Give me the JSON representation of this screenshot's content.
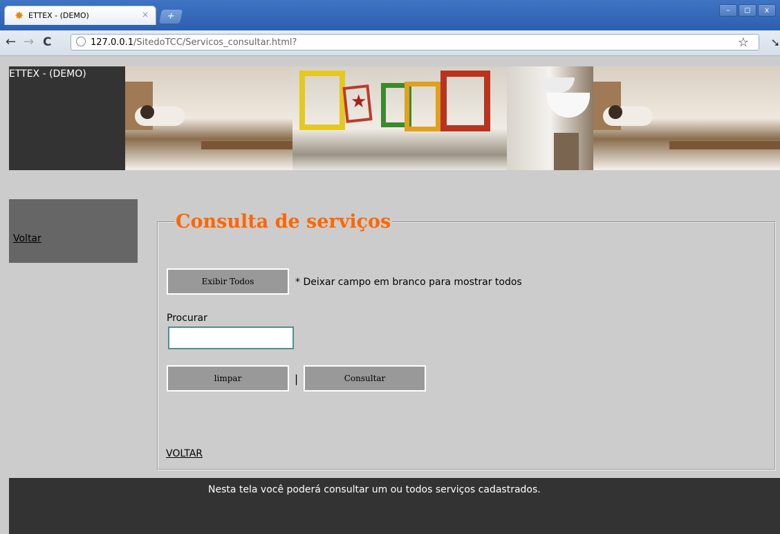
{
  "browser": {
    "tab_title": "ETTEX - (DEMO)",
    "tab_close": "×",
    "new_tab": "+",
    "url_host": "127.0.0.1",
    "url_path": "/SitedoTCC/Servicos_consultar.html?",
    "window_controls": {
      "minimize": "–",
      "maximize": "◻",
      "close": "x"
    },
    "icons": {
      "back": "←",
      "forward": "→",
      "reload": "C",
      "star": "☆",
      "wrench": "➘"
    }
  },
  "header": {
    "site_title": "ETTEX - (DEMO)"
  },
  "sidebar": {
    "links": [
      {
        "label": "Voltar"
      }
    ]
  },
  "main": {
    "legend": "Consulta de serviços",
    "show_all_button": "Exibir Todos",
    "show_all_note": "* Deixar campo em branco para mostrar todos",
    "search_label": "Procurar",
    "search_value": "",
    "clear_button": "limpar",
    "separator": "|",
    "query_button": "Consultar",
    "back_link": "VOLTAR"
  },
  "footer": {
    "text": "Nesta tela você poderá consultar um ou todos serviços cadastrados."
  },
  "colors": {
    "page_background": "#cccccc",
    "dark_panel": "#333333",
    "side_menu": "#666666",
    "legend_orange": "#ff6600",
    "button_gray": "#999999"
  }
}
